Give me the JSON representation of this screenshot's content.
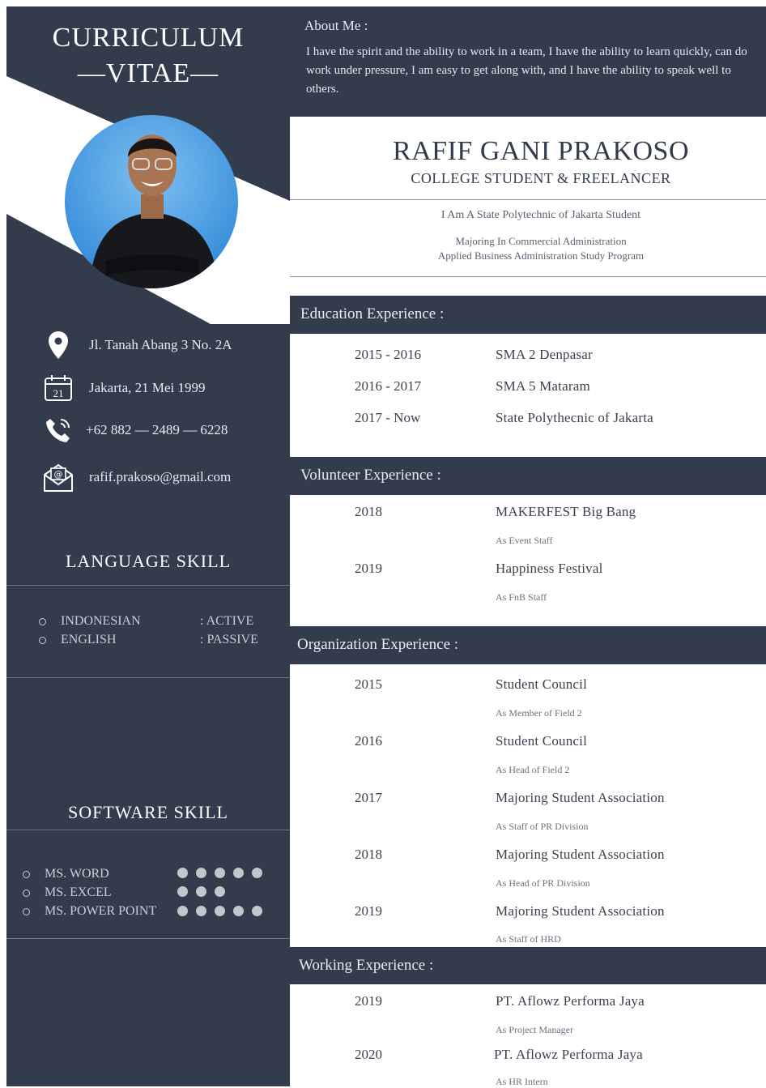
{
  "sidebar": {
    "title_line1": "CURRICULUM",
    "title_line2": "—VITAE—",
    "contacts": [
      {
        "icon": "location-pin-icon",
        "text": "Jl. Tanah Abang 3 No. 2A"
      },
      {
        "icon": "calendar-icon",
        "calendar_day": "21",
        "text": "Jakarta, 21 Mei 1999"
      },
      {
        "icon": "phone-icon",
        "text": "+62 882 — 2489 — 6228"
      },
      {
        "icon": "email-icon",
        "text": "rafif.prakoso@gmail.com"
      }
    ],
    "language_heading": "LANGUAGE SKILL",
    "languages": [
      {
        "name": "INDONESIAN",
        "level": ": ACTIVE"
      },
      {
        "name": "ENGLISH",
        "level": ": PASSIVE"
      }
    ],
    "software_heading": "SOFTWARE SKILL",
    "software": [
      {
        "name": "MS. WORD",
        "rating": 5
      },
      {
        "name": "MS. EXCEL",
        "rating": 3
      },
      {
        "name": "MS. POWER POINT",
        "rating": 5
      }
    ]
  },
  "about": {
    "label": "About Me :",
    "text": "I have the spirit and the ability to work in a team, I have the ability to learn quickly, can do work under pressure, I am easy to get along with, and I have the ability to speak well to others."
  },
  "header": {
    "name": "RAFIF GANI PRAKOSO",
    "role": "COLLEGE STUDENT & FREELANCER",
    "intro1": "I Am A State Polytechnic of Jakarta Student",
    "intro2": "Majoring In Commercial Administration",
    "intro3": "Applied Business Administration Study Program"
  },
  "education": {
    "heading": "Education Experience :",
    "items": [
      {
        "year": "2015 - 2016",
        "place": "SMA 2 Denpasar"
      },
      {
        "year": "2016 - 2017",
        "place": "SMA 5 Mataram"
      },
      {
        "year": "2017 - Now",
        "place": "State Polythecnic of Jakarta"
      }
    ]
  },
  "volunteer": {
    "heading": "Volunteer Experience :",
    "items": [
      {
        "year": "2018",
        "event": "MAKERFEST Big Bang",
        "role": "As Event Staff"
      },
      {
        "year": "2019",
        "event": "Happiness Festival",
        "role": "As FnB Staff"
      }
    ]
  },
  "organization": {
    "heading": "Organization Experience :",
    "items": [
      {
        "year": "2015",
        "org": "Student Council",
        "role": "As Member of Field 2"
      },
      {
        "year": "2016",
        "org": "Student Council",
        "role": "As Head of Field 2"
      },
      {
        "year": "2017",
        "org": "Majoring Student Association",
        "role": "As Staff of PR Division"
      },
      {
        "year": "2018",
        "org": "Majoring Student Association",
        "role": "As Head of PR Division"
      },
      {
        "year": "2019",
        "org": "Majoring Student Association",
        "role": "As Staff of HRD"
      }
    ]
  },
  "working": {
    "heading": "Working Experience :",
    "items": [
      {
        "year": "2019",
        "company": "PT. Aflowz Performa Jaya",
        "role": "As Project Manager"
      },
      {
        "year": "2020",
        "company": "PT. Aflowz Performa Jaya",
        "role": "As HR Intern"
      }
    ]
  },
  "colors": {
    "navy": "#323c4d",
    "white": "#ffffff"
  }
}
